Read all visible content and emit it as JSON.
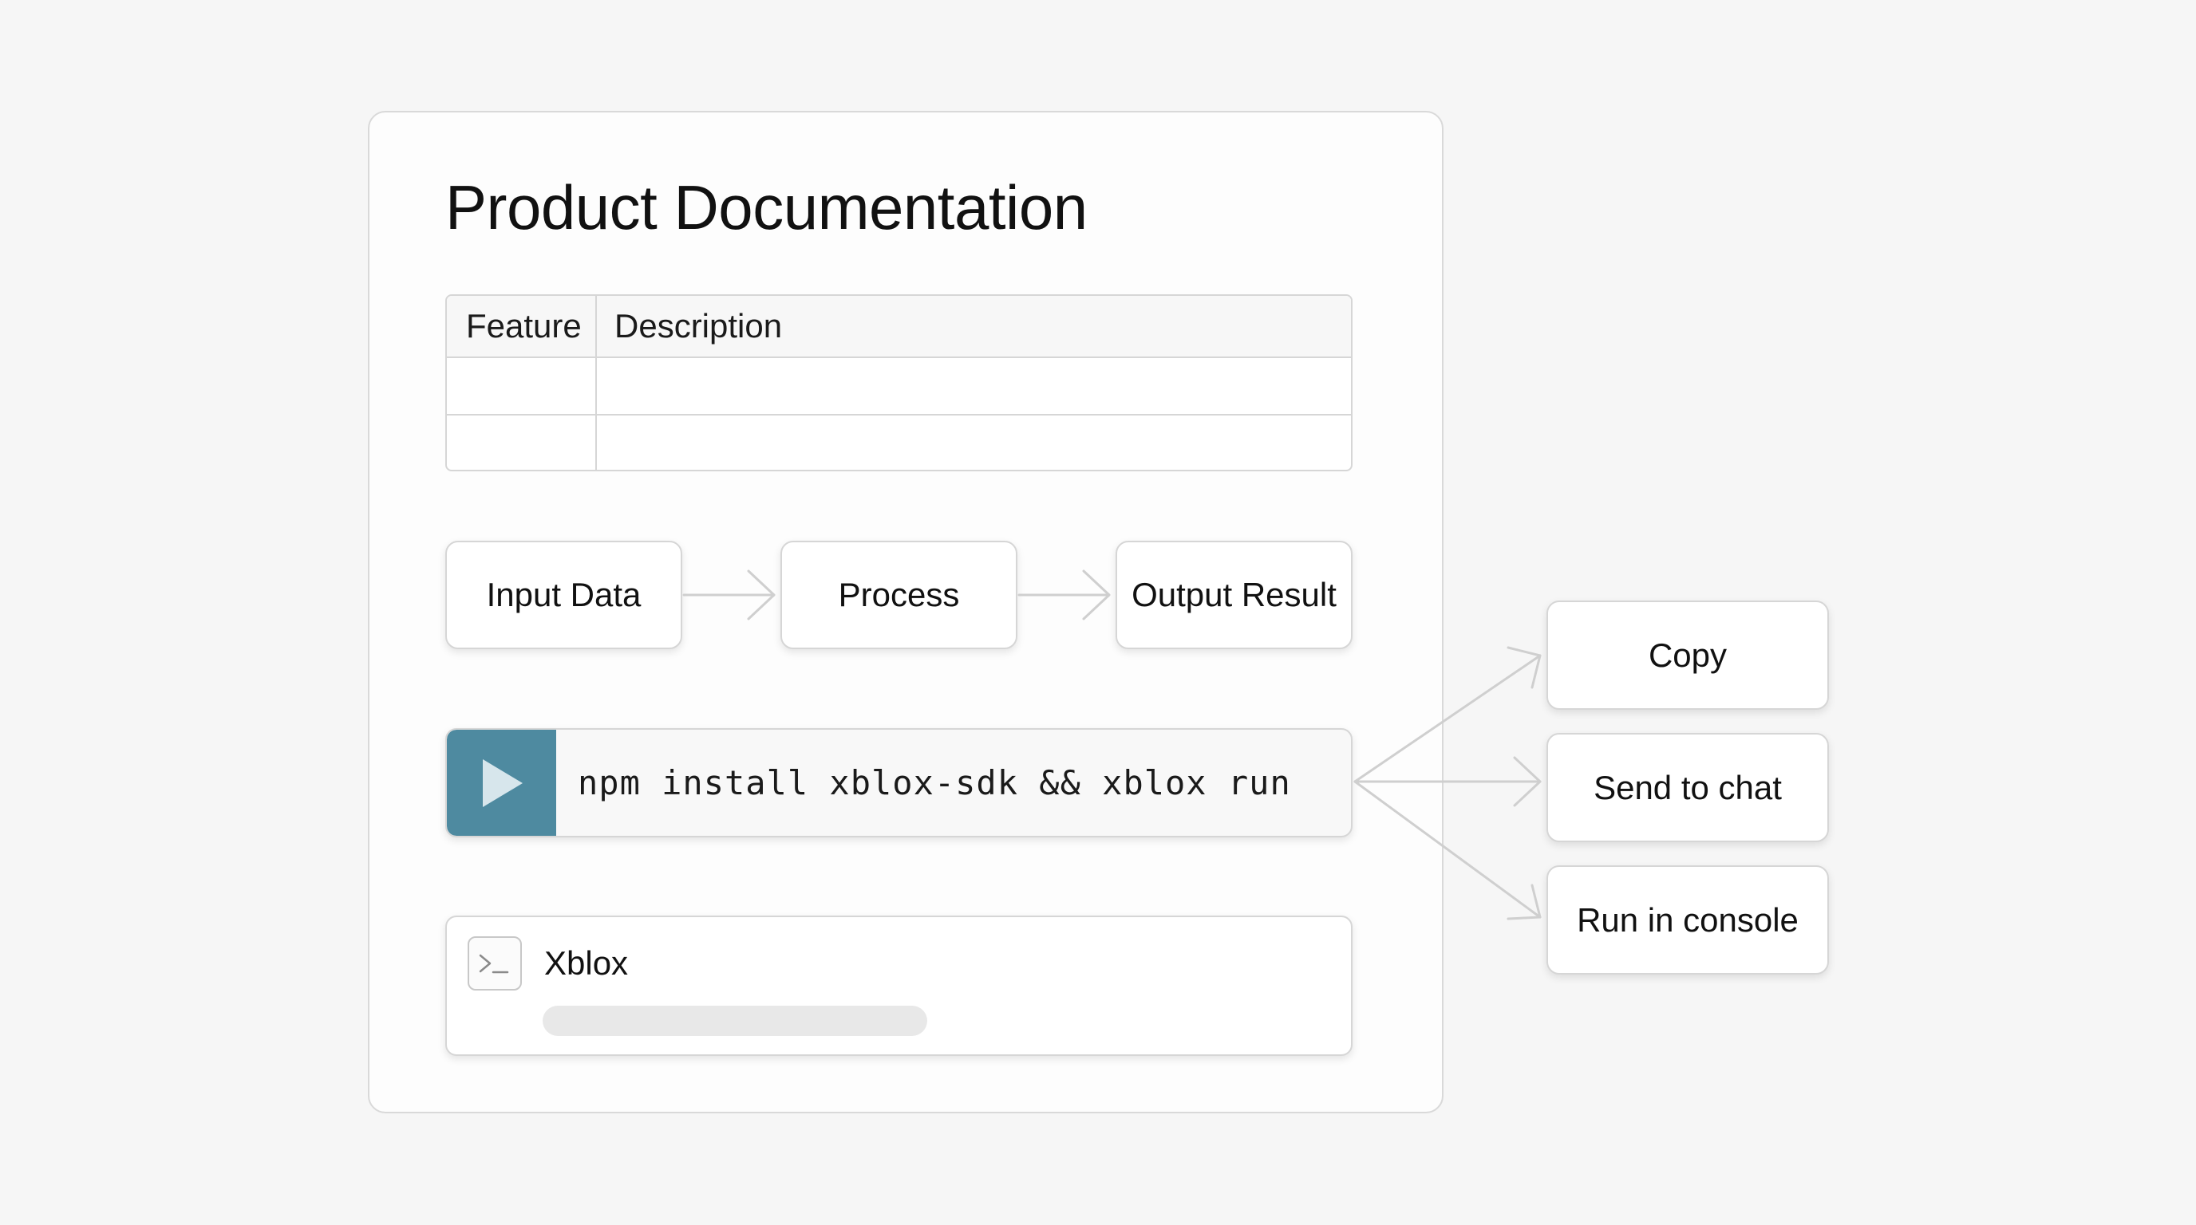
{
  "document": {
    "title": "Product Documentation",
    "table": {
      "headers": [
        "Feature",
        "Description"
      ],
      "rows": [
        [
          "",
          ""
        ],
        [
          "",
          ""
        ]
      ]
    },
    "flow": {
      "steps": [
        "Input Data",
        "Process",
        "Output Result"
      ]
    },
    "command": {
      "text": "npm install xblox-sdk && xblox run",
      "run_icon": "play-icon",
      "run_color": "#4e8aa0"
    },
    "console_card": {
      "icon": "terminal-icon",
      "name": "Xblox"
    }
  },
  "actions": {
    "items": [
      "Copy",
      "Send to chat",
      "Run in console"
    ]
  }
}
